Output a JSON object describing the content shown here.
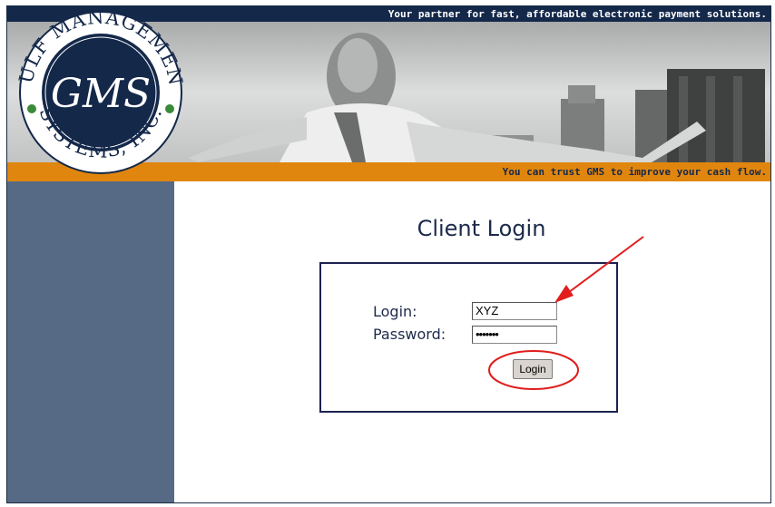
{
  "header": {
    "tagline": "Your partner for fast, affordable electronic payment solutions.",
    "subtagline": "You can trust GMS to improve your cash flow."
  },
  "logo": {
    "company_top": "GULF MANAGEMENT",
    "company_bottom": "SYSTEMS, INC.",
    "monogram": "GMS"
  },
  "login": {
    "title": "Client Login",
    "login_label": "Login:",
    "password_label": "Password:",
    "login_value": "XYZ",
    "password_value": "•••••••",
    "button_label": "Login"
  },
  "colors": {
    "navy": "#14284a",
    "orange": "#e0860e",
    "sidebar": "#566a85",
    "annotation_red": "#e11d1d"
  }
}
